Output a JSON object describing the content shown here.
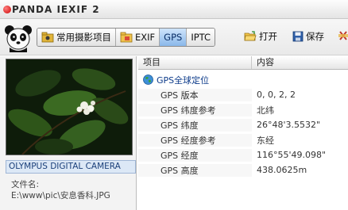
{
  "app": {
    "title": "PANDA IEXIF 2"
  },
  "toolbar": {
    "tabs": [
      {
        "label": "常用摄影项目",
        "icon": "camera-folder-icon",
        "active": false
      },
      {
        "label": "EXIF",
        "icon": "folder-icon",
        "active": false
      },
      {
        "label": "GPS",
        "icon": "",
        "active": true
      },
      {
        "label": "IPTC",
        "icon": "",
        "active": false
      }
    ],
    "open_label": "打开",
    "save_label": "保存"
  },
  "preview": {
    "caption": "OLYMPUS DIGITAL CAMERA",
    "filename_label": "文件名:",
    "filename_path": "E:\\www\\pic\\安息香科.JPG"
  },
  "table": {
    "headers": [
      "项目",
      "内容"
    ],
    "group": {
      "label": "GPS全球定位",
      "icon": "globe-icon"
    },
    "rows": [
      {
        "item": "GPS 版本",
        "value": "0, 0, 2, 2"
      },
      {
        "item": "GPS 纬度参考",
        "value": "北纬"
      },
      {
        "item": "GPS 纬度",
        "value": "26°48'3.5532\""
      },
      {
        "item": "GPS 经度参考",
        "value": "东经"
      },
      {
        "item": "GPS 经度",
        "value": "116°55'49.098\""
      },
      {
        "item": "GPS 高度",
        "value": "438.0625m"
      }
    ]
  },
  "colors": {
    "active_tab": "#8ab8ea",
    "caption_bg": "#dce8f6",
    "group_text": "#0d3b8a"
  }
}
